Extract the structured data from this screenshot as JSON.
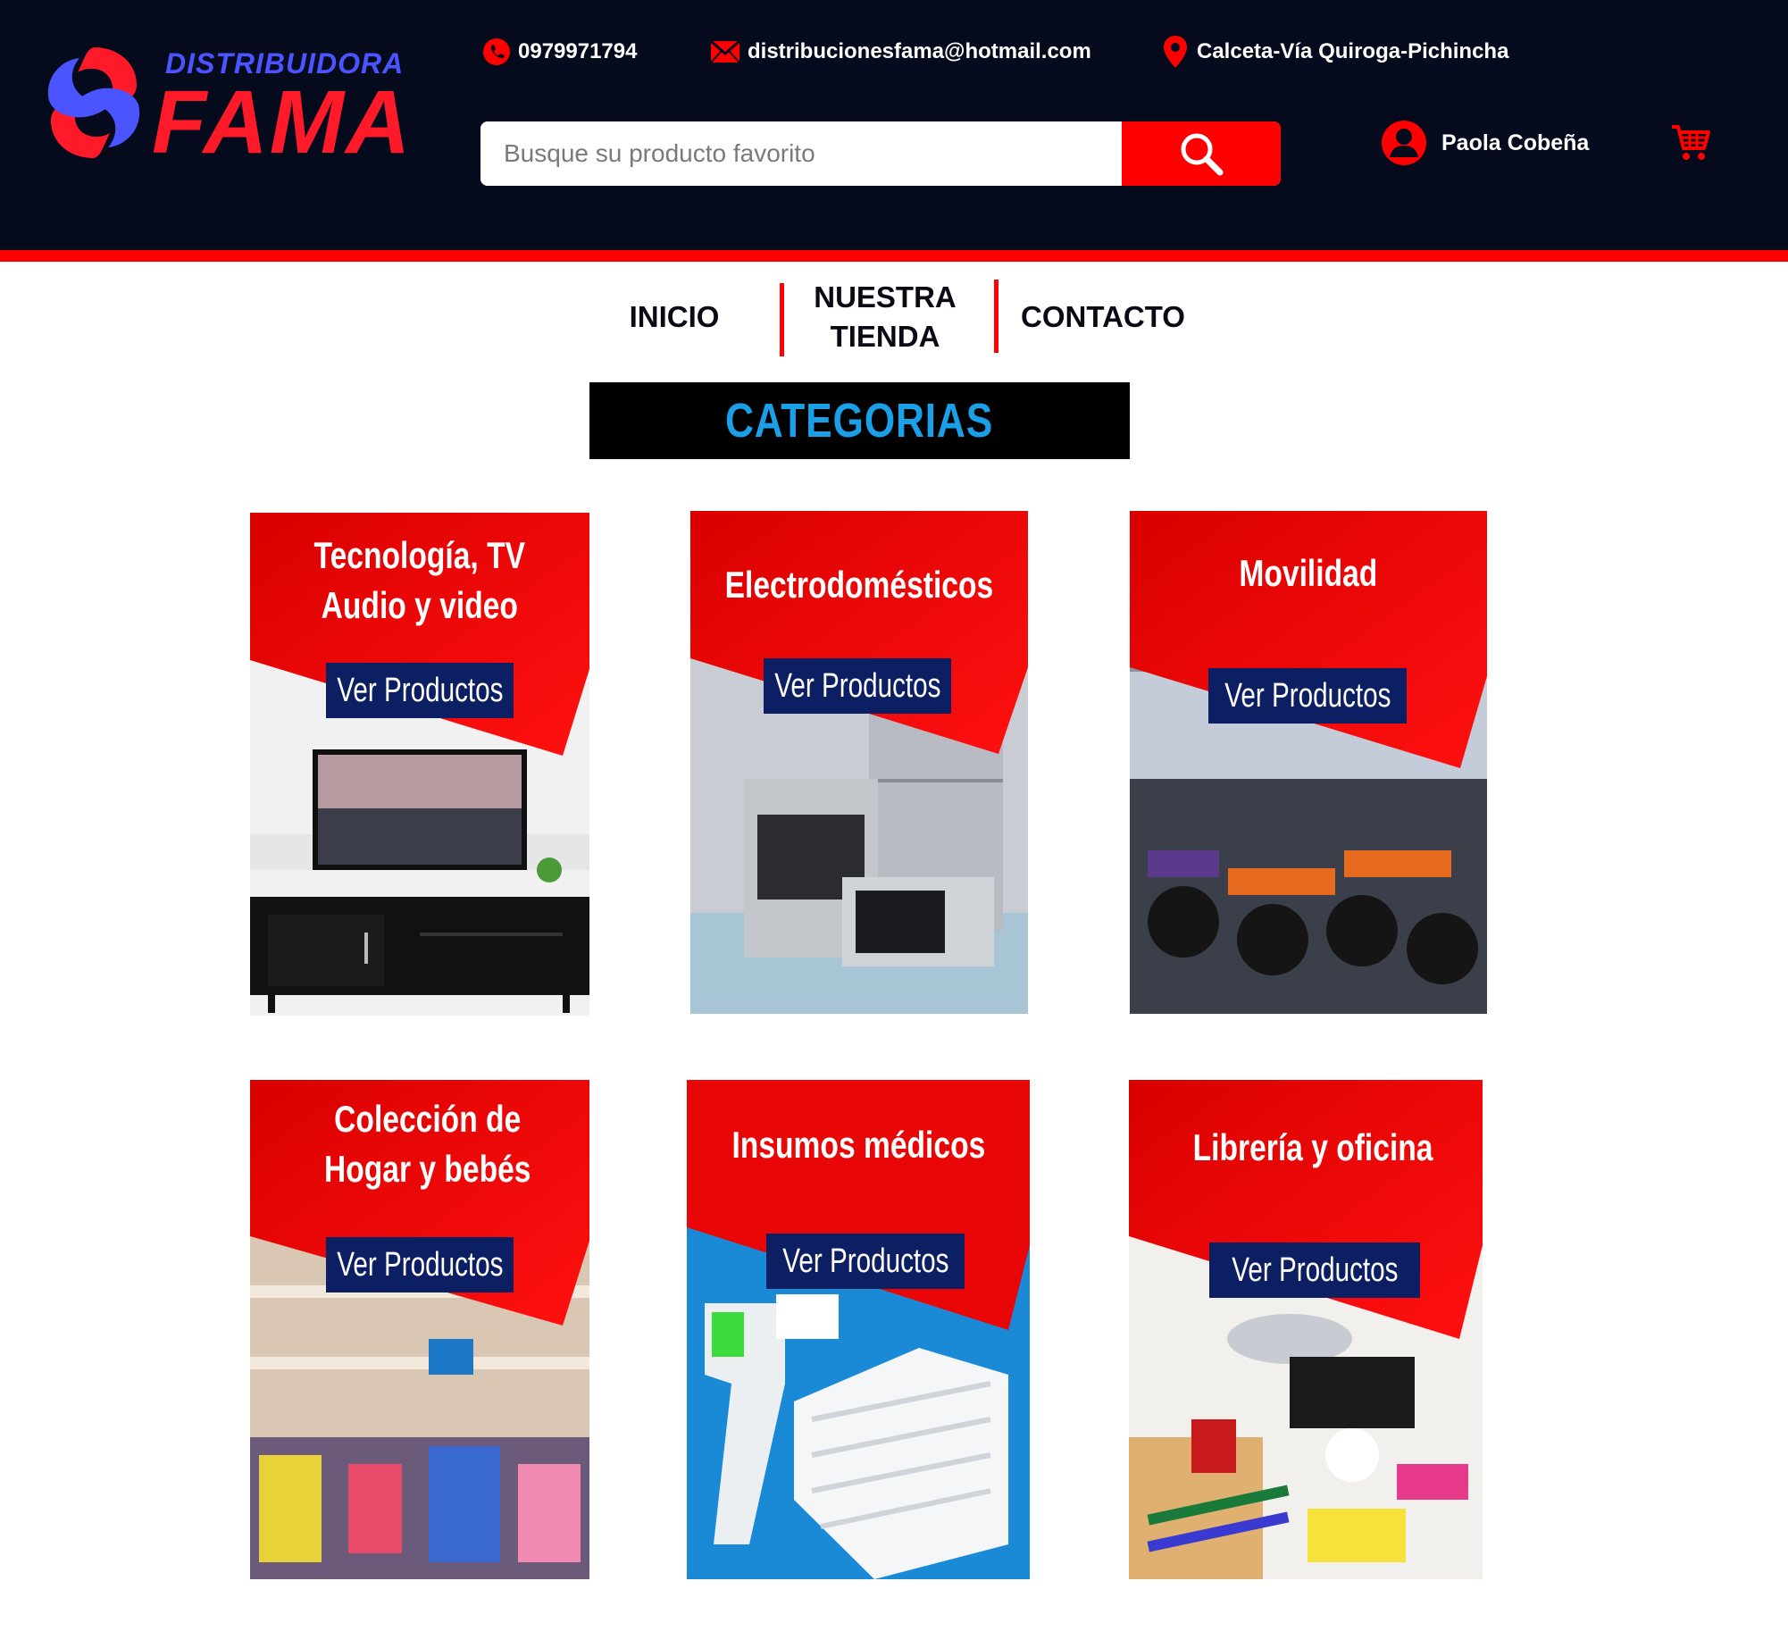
{
  "brand": {
    "top": "DISTRIBUIDORA",
    "main": "FAMA"
  },
  "contact": {
    "phone": "0979971794",
    "email": "distribucionesfama@hotmail.com",
    "address": "Calceta-Vía Quiroga-Pichincha"
  },
  "search": {
    "placeholder": "Busque su producto favorito",
    "value": ""
  },
  "user": {
    "name": "Paola Cobeña"
  },
  "nav": {
    "inicio": "INICIO",
    "tienda_line1": "NUESTRA",
    "tienda_line2": "TIENDA",
    "contacto": "CONTACTO"
  },
  "categories_title": "CATEGORIAS",
  "categories": [
    {
      "label": "Tecnología, TV\nAudio y video",
      "button": "Ver Productos"
    },
    {
      "label": "Electrodomésticos",
      "button": "Ver Productos"
    },
    {
      "label": "Movilidad",
      "button": "Ver Productos"
    },
    {
      "label": "Colección de\nHogar y bebés",
      "button": "Ver Productos"
    },
    {
      "label": "Insumos médicos",
      "button": "Ver Productos"
    },
    {
      "label": "Librería y oficina",
      "button": "Ver Productos"
    }
  ],
  "colors": {
    "header_bg": "#050a1c",
    "accent_red": "#ff0000",
    "button_navy": "#0c1f63",
    "title_blue": "#1aa0e8"
  },
  "icons": [
    "phone-icon",
    "mail-icon",
    "location-pin-icon",
    "search-icon",
    "user-icon",
    "cart-icon",
    "logo-swirl-icon"
  ]
}
